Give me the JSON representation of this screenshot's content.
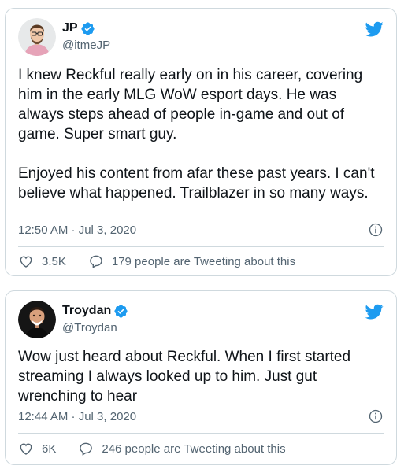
{
  "tweets": [
    {
      "display_name": "JP",
      "handle": "@itmeJP",
      "text": "I knew Reckful really early on in his career, covering him in the early MLG WoW esport days. He was always steps ahead of people in-game and out of game. Super smart guy.\n\nEnjoyed his content from afar these past years. I can't believe what happened. Trailblazer in so many ways.",
      "timestamp": "12:50 AM · Jul 3, 2020",
      "likes": "3.5K",
      "replies_label": "179 people are Tweeting about this"
    },
    {
      "display_name": "Troydan",
      "handle": "@Troydan",
      "text": "Wow just heard about Reckful. When I first started streaming I always looked up to him. Just gut wrenching to hear",
      "timestamp": "12:44 AM · Jul 3, 2020",
      "likes": "6K",
      "replies_label": "246 people are Tweeting about this"
    }
  ],
  "colors": {
    "brand_blue": "#1d9bf0",
    "text_primary": "#0f1419",
    "text_secondary": "#536471",
    "border": "#cfd9de"
  },
  "icons": [
    "avatar",
    "verified-badge-icon",
    "twitter-bird-icon",
    "info-icon",
    "heart-icon",
    "speech-bubble-icon"
  ]
}
